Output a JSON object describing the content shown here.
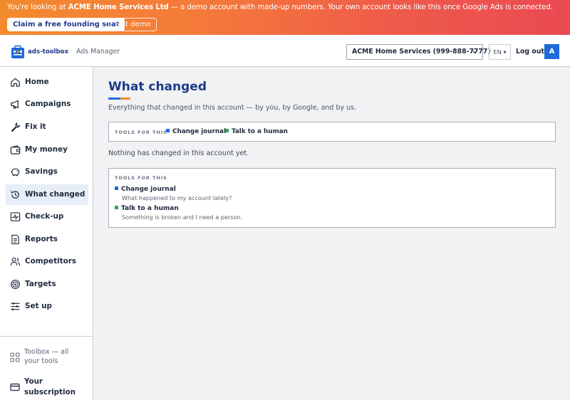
{
  "banner": {
    "prefix": "You're looking at ",
    "account_name": "ACME Home Services Ltd",
    "suffix": " — a demo account with made-up numbers. Your own account looks like this once Google Ads is connected.",
    "claim_label": "Claim a free founding seat",
    "exit_label": "Exit demo"
  },
  "header": {
    "logo_text": "ads-toolbox",
    "app_label": "Ads Manager",
    "account_selector": "ACME Home Services (999-888-7777)",
    "language": "EN ▾",
    "logout_label": "Log out",
    "avatar_initial": "A"
  },
  "sidebar": {
    "items": [
      {
        "label": "Home",
        "icon": "home-icon"
      },
      {
        "label": "Campaigns",
        "icon": "megaphone-icon"
      },
      {
        "label": "Fix it",
        "icon": "wrench-icon"
      },
      {
        "label": "My money",
        "icon": "wallet-icon"
      },
      {
        "label": "Savings",
        "icon": "piggy-bank-icon"
      },
      {
        "label": "What changed",
        "icon": "history-icon",
        "active": true
      },
      {
        "label": "Check-up",
        "icon": "pulse-icon"
      },
      {
        "label": "Reports",
        "icon": "document-icon"
      },
      {
        "label": "Competitors",
        "icon": "users-icon"
      },
      {
        "label": "Targets",
        "icon": "target-icon"
      },
      {
        "label": "Set up",
        "icon": "sliders-icon"
      }
    ],
    "bottom": {
      "toolbox_label": "Toolbox — all your tools",
      "subscription_label": "Your subscription"
    }
  },
  "main": {
    "title": "What changed",
    "subtitle": "Everything that changed in this account — by you, by Google, and by us.",
    "tools_caption": "TOOLS FOR THIS",
    "empty_message": "Nothing has changed in this account yet.",
    "tools": [
      {
        "name": "Change journal",
        "desc": "What happened to my account lately?",
        "color": "#1e6ad8"
      },
      {
        "name": "Talk to a human",
        "desc": "Something is broken and I need a person.",
        "color": "#2ea84f"
      }
    ]
  },
  "colors": {
    "brand_blue": "#1e6ad8",
    "title_navy": "#1f3a8a",
    "accent_orange": "#f28a2e",
    "accent_green": "#2ea84f"
  }
}
